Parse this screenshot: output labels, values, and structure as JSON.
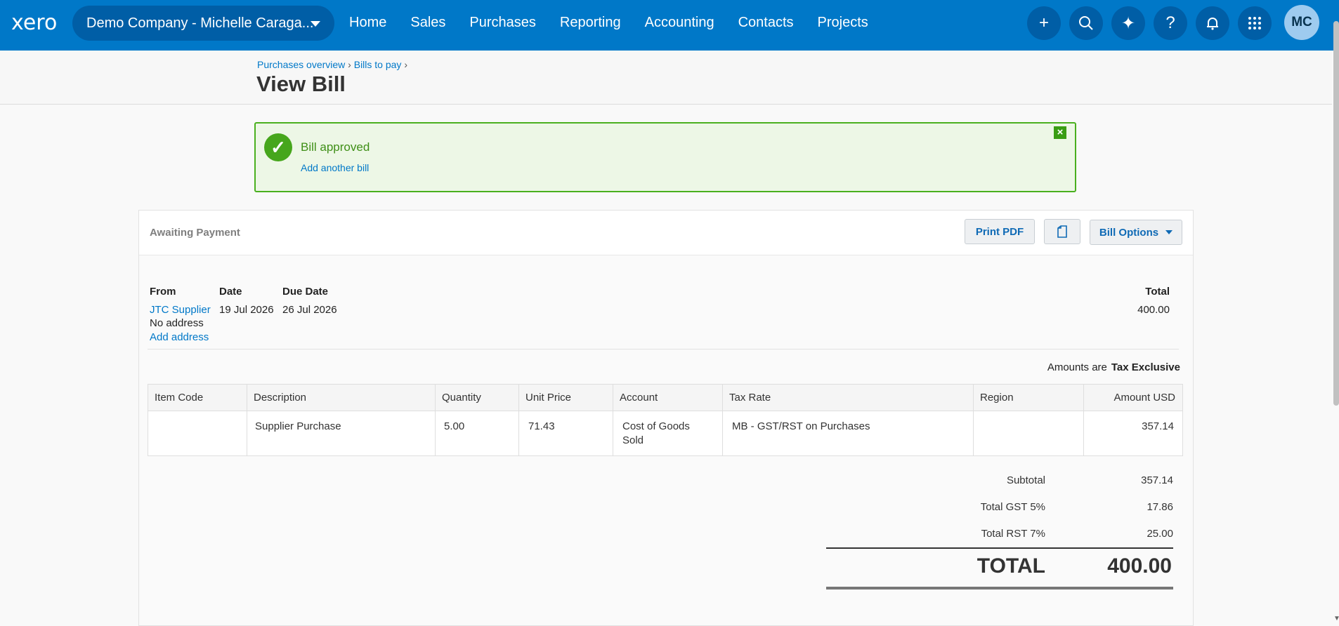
{
  "nav": {
    "logo": "xero",
    "org": "Demo Company - Michelle Caraga...",
    "links": [
      "Home",
      "Sales",
      "Purchases",
      "Reporting",
      "Accounting",
      "Contacts",
      "Projects"
    ],
    "icons": [
      "plus-icon",
      "search-icon",
      "sparkle-icon",
      "help-icon",
      "bell-icon",
      "apps-grid-icon"
    ],
    "avatar": "MC",
    "brand_color": "#0078c8"
  },
  "header": {
    "breadcrumb": [
      "Purchases overview",
      "Bills to pay"
    ],
    "title": "View Bill"
  },
  "banner": {
    "message": "Bill approved",
    "link": "Add another bill"
  },
  "bill": {
    "status": "Awaiting Payment",
    "buttons": {
      "print": "Print PDF",
      "options": "Bill Options"
    },
    "labels": {
      "from": "From",
      "date": "Date",
      "due_date": "Due Date",
      "total": "Total"
    },
    "from": "JTC Supplier",
    "address": "No address",
    "add_address": "Add address",
    "date": "19 Jul 2026",
    "due_date": "26 Jul 2026",
    "total": "400.00",
    "amounts_are_label": "Amounts are",
    "amounts_are_value": "Tax Exclusive"
  },
  "table": {
    "headers": [
      "Item Code",
      "Description",
      "Quantity",
      "Unit Price",
      "Account",
      "Tax Rate",
      "Region",
      "Amount USD"
    ],
    "rows": [
      {
        "item_code": "",
        "description": "Supplier Purchase",
        "quantity": "5.00",
        "unit_price": "71.43",
        "account_line1": "Cost of Goods",
        "account_line2": "Sold",
        "tax_rate": "MB - GST/RST on Purchases",
        "region": "",
        "amount": "357.14"
      }
    ]
  },
  "totals": {
    "subtotal_label": "Subtotal",
    "subtotal": "357.14",
    "gst_label": "Total GST 5%",
    "gst": "17.86",
    "rst_label": "Total RST 7%",
    "rst": "25.00",
    "total_label": "TOTAL",
    "total": "400.00"
  }
}
